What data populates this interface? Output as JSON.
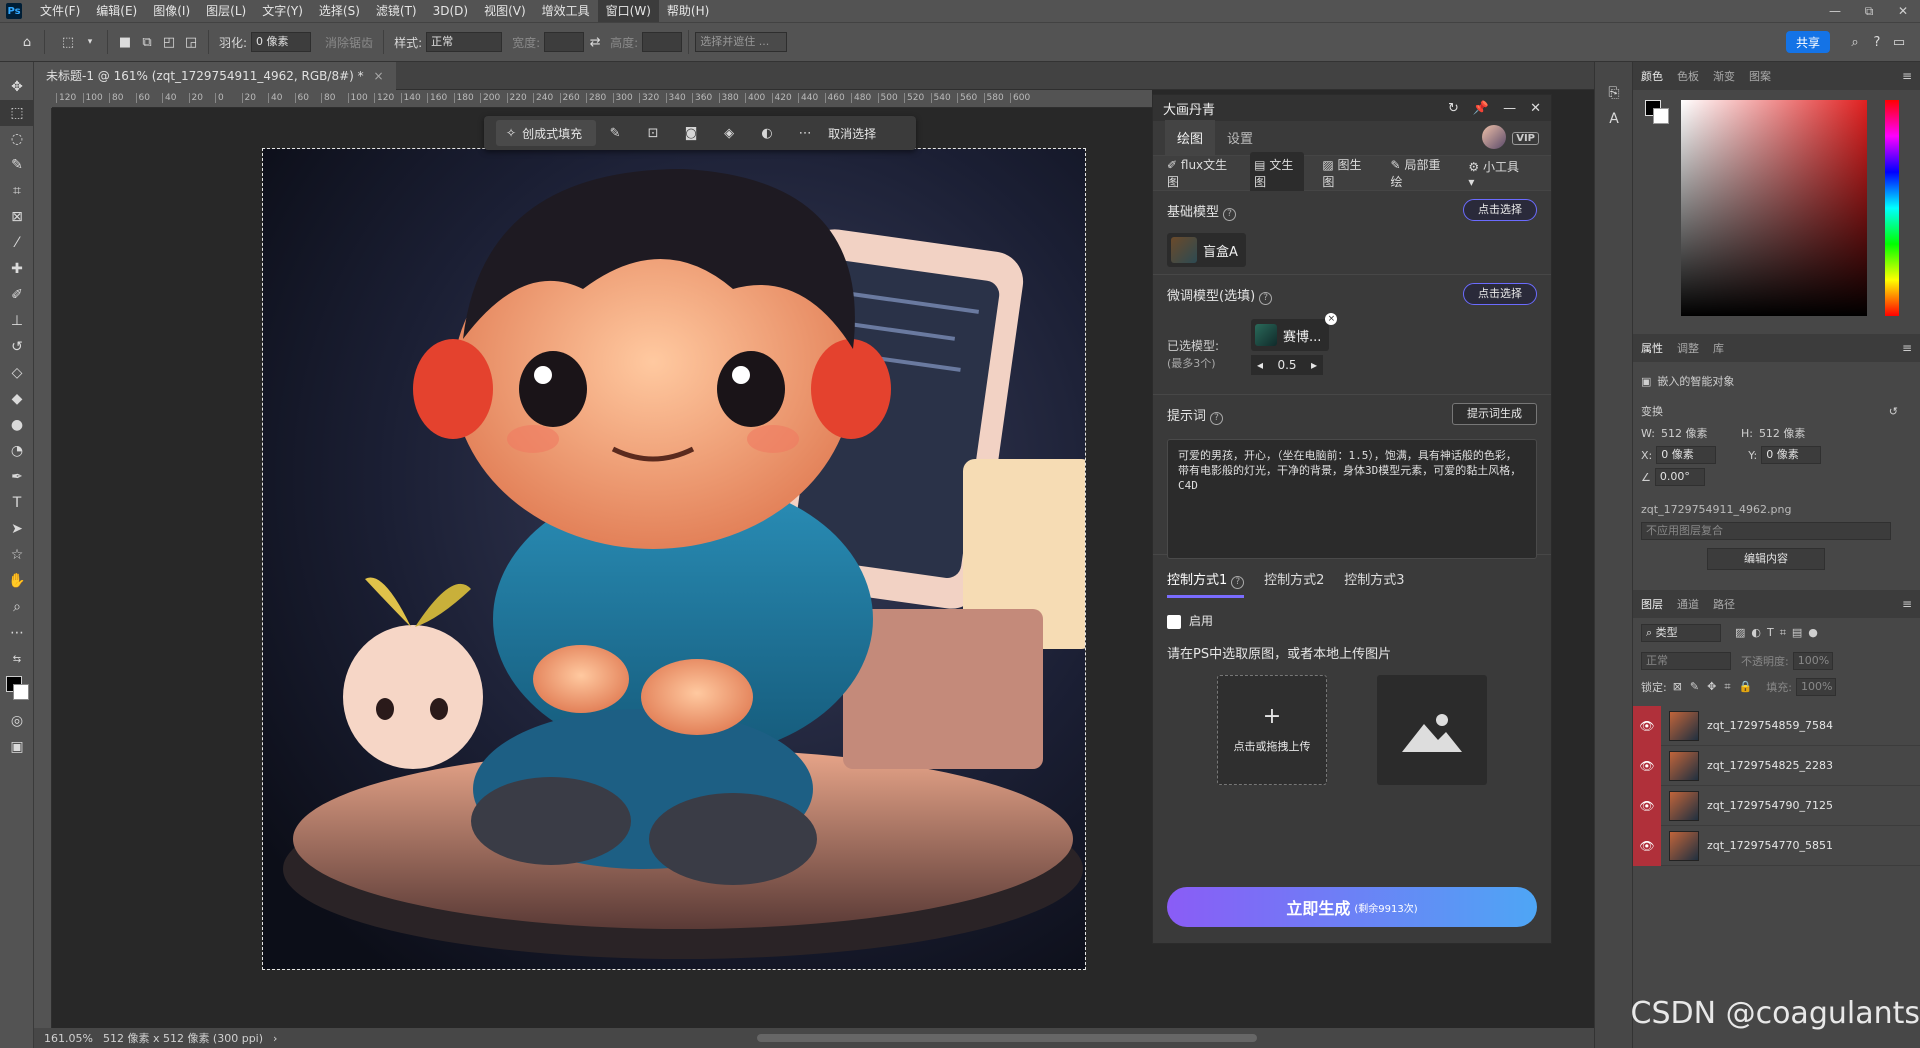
{
  "menubar": {
    "logo": "Ps",
    "items": [
      "文件(F)",
      "编辑(E)",
      "图像(I)",
      "图层(L)",
      "文字(Y)",
      "选择(S)",
      "滤镜(T)",
      "3D(D)",
      "视图(V)",
      "增效工具",
      "窗口(W)",
      "帮助(H)"
    ],
    "controls": [
      "—",
      "⧉",
      "✕"
    ]
  },
  "optbar": {
    "feather_label": "羽化:",
    "feather_value": "0 像素",
    "antialias_label": "消除锯齿",
    "style_label": "样式:",
    "style_value": "正常",
    "width_label": "宽度:",
    "height_label": "高度:",
    "select_mask_label": "选择并遮住 ...",
    "share_label": "共享"
  },
  "doc": {
    "tab_title": "未标题-1 @ 161% (zqt_1729754911_4962, RGB/8#) *",
    "ruler_ticks": [
      "120",
      "100",
      "80",
      "60",
      "40",
      "20",
      "0",
      "20",
      "40",
      "60",
      "80",
      "100",
      "120",
      "140",
      "160",
      "180",
      "200",
      "220",
      "240",
      "260",
      "280",
      "300",
      "320",
      "340",
      "360",
      "380",
      "400",
      "420",
      "440",
      "460",
      "480",
      "500",
      "520",
      "540",
      "560",
      "580",
      "600"
    ]
  },
  "context_bar": {
    "fill_label": "创成式填充",
    "cancel_label": "取消选择"
  },
  "plugin": {
    "title": "大画丹青",
    "tabs": [
      "绘图",
      "设置"
    ],
    "vip_label": "VIP",
    "modes": [
      "flux文生图",
      "文生图",
      "图生图",
      "局部重绘",
      "小工具"
    ],
    "base_model": {
      "heading": "基础模型",
      "select_label": "点击选择",
      "model_name": "盲盒A"
    },
    "lora": {
      "heading": "微调模型(选填)",
      "select_label": "点击选择",
      "selected_label": "已选模型:",
      "max_label": "(最多3个)",
      "model_name": "赛博...",
      "weight": "0.5"
    },
    "prompt": {
      "heading": "提示词",
      "gen_label": "提示词生成",
      "text": "可爱的男孩，开心，（坐在电脑前：1.5），饱满，具有神话般的色彩，带有电影般的灯光，干净的背景，身体3D模型元素，可爱的黏土风格，C4D"
    },
    "control": {
      "tabs": [
        "控制方式1",
        "控制方式2",
        "控制方式3"
      ],
      "enable_label": "启用",
      "hint": "请在PS中选取原图，或者本地上传图片",
      "upload_label": "点击或拖拽上传"
    },
    "generate": {
      "label": "立即生成",
      "remaining": "(剩余9913次)"
    }
  },
  "right_panels": {
    "color_tabs": [
      "颜色",
      "色板",
      "渐变",
      "图案"
    ],
    "props_tabs": [
      "属性",
      "调整",
      "库"
    ],
    "smart_object_label": "嵌入的智能对象",
    "transform_label": "变换",
    "w_label": "W:",
    "w_value": "512 像素",
    "h_label": "H:",
    "h_value": "512 像素",
    "x_label": "X:",
    "x_value": "0 像素",
    "y_label": "Y:",
    "y_value": "0 像素",
    "angle_value": "0.00°",
    "filename": "zqt_1729754911_4962.png",
    "comp_label": "不应用图层复合",
    "edit_label": "编辑内容",
    "layers_tabs": [
      "图层",
      "通道",
      "路径"
    ],
    "kind_label": "类型",
    "blend_label": "正常",
    "opacity_label": "不透明度:",
    "opacity_value": "100%",
    "lock_label": "锁定:",
    "fill_label": "填充:",
    "fill_value": "100%",
    "layers": [
      "zqt_1729754859_7584",
      "zqt_1729754825_2283",
      "zqt_1729754790_7125",
      "zqt_1729754770_5851"
    ]
  },
  "status": {
    "zoom": "161.05%",
    "size": "512 像素 x 512 像素 (300 ppi)"
  },
  "watermark": "CSDN @coagulants"
}
